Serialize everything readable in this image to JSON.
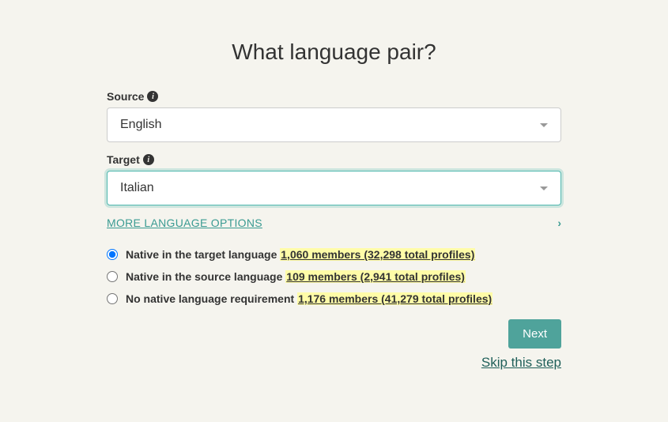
{
  "title": "What language pair?",
  "source": {
    "label": "Source",
    "value": "English"
  },
  "target": {
    "label": "Target",
    "value": "Italian"
  },
  "more_options": "MORE LANGUAGE OPTIONS",
  "radios": {
    "native_target": {
      "label": "Native in the target language",
      "stat": "1,060 members (32,298 total profiles)"
    },
    "native_source": {
      "label": "Native in the source language",
      "stat": "109 members (2,941 total profiles)"
    },
    "no_native": {
      "label": "No native language requirement",
      "stat": "1,176 members (41,279 total profiles)"
    }
  },
  "actions": {
    "next": "Next",
    "skip": "Skip this step"
  }
}
